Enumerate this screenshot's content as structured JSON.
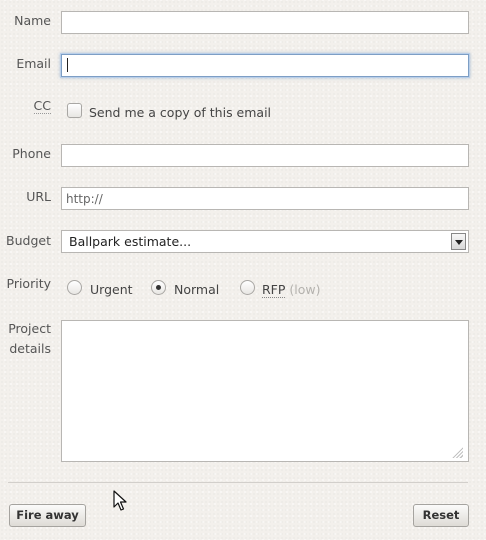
{
  "form": {
    "name": {
      "label": "Name",
      "value": ""
    },
    "email": {
      "label": "Email",
      "value": ""
    },
    "cc": {
      "label": "CC",
      "checkbox_label": "Send me a copy of this email",
      "checked": false
    },
    "phone": {
      "label": "Phone",
      "value": ""
    },
    "url": {
      "label": "URL",
      "placeholder": "http://"
    },
    "budget": {
      "label": "Budget",
      "selected": "Ballpark estimate..."
    },
    "priority": {
      "label": "Priority",
      "options": [
        {
          "label": "Urgent",
          "checked": false
        },
        {
          "label": "Normal",
          "checked": true
        },
        {
          "label": "RFP",
          "note": "(low)",
          "checked": false
        }
      ]
    },
    "project_details": {
      "label_line1": "Project",
      "label_line2": "details",
      "value": ""
    }
  },
  "actions": {
    "submit_label": "Fire away",
    "reset_label": "Reset"
  },
  "colors": {
    "background": "#f3f0ec",
    "focus_border": "#7d9ec5"
  }
}
